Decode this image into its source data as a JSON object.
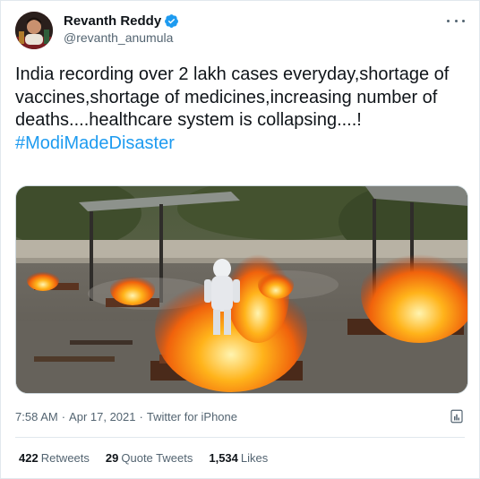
{
  "author": {
    "display_name": "Revanth Reddy",
    "handle": "@revanth_anumula",
    "verified_badge": "verified-badge-icon"
  },
  "tweet": {
    "text": "India recording over 2 lakh cases everyday,shortage of vaccines,shortage of medicines,increasing number of deaths....healthcare system is collapsing....!",
    "hashtag": "#ModiMadeDisaster"
  },
  "meta": {
    "time": "7:58 AM",
    "separator": "·",
    "date": "Apr 17, 2021",
    "source": "Twitter for iPhone"
  },
  "stats": {
    "retweets_count": "422",
    "retweets_label": "Retweets",
    "quotes_count": "29",
    "quotes_label": "Quote Tweets",
    "likes_count": "1,534",
    "likes_label": "Likes"
  },
  "colors": {
    "accent": "#1d9bf0",
    "secondary_text": "#536471",
    "border": "#e1e8ed"
  },
  "icons": [
    "more-icon",
    "verified-badge-icon",
    "analytics-icon"
  ]
}
